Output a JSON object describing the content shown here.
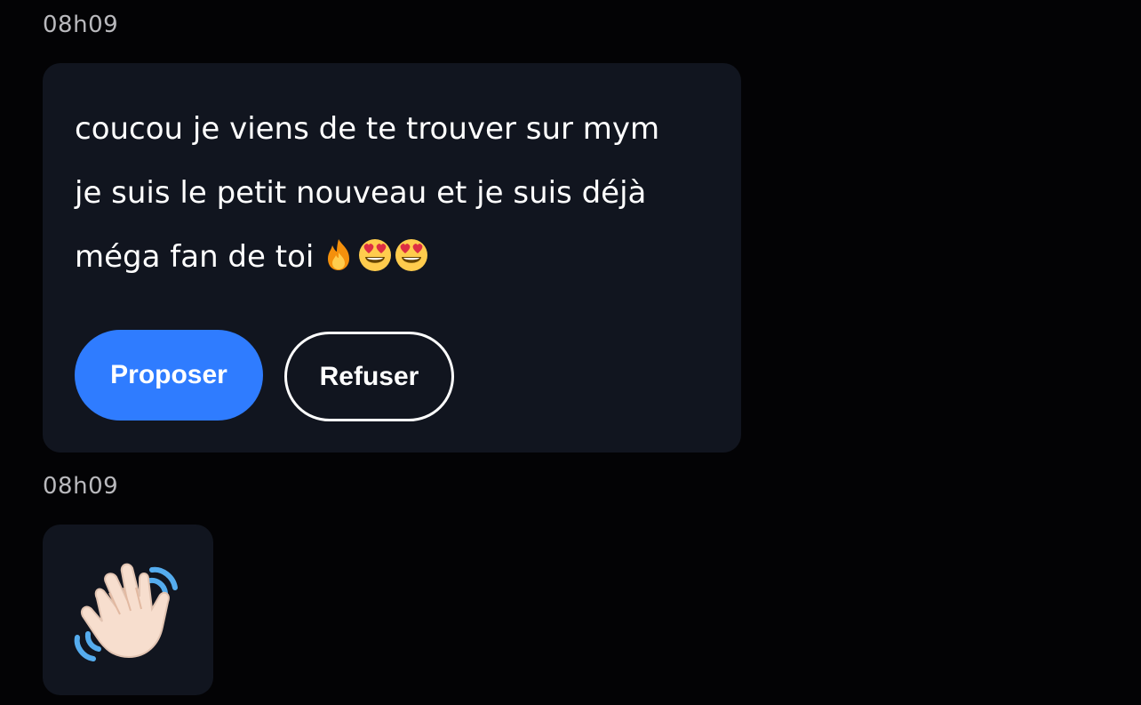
{
  "messages": [
    {
      "timestamp": "08h09",
      "lines": [
        "coucou je viens de te trouver sur mym",
        "je suis le petit nouveau et je suis déjà",
        "méga fan de toi"
      ],
      "emojis": [
        "fire-emoji",
        "heart-eyes-emoji",
        "heart-eyes-emoji"
      ],
      "actions": {
        "propose_label": "Proposer",
        "refuse_label": "Refuser"
      }
    },
    {
      "timestamp": "08h09",
      "sticker": "waving-hand-emoji"
    }
  ],
  "colors": {
    "background": "#030305",
    "bubble": "#11151f",
    "primary_button": "#2f7cff",
    "text": "#ffffff",
    "timestamp": "#b9b9bd"
  }
}
